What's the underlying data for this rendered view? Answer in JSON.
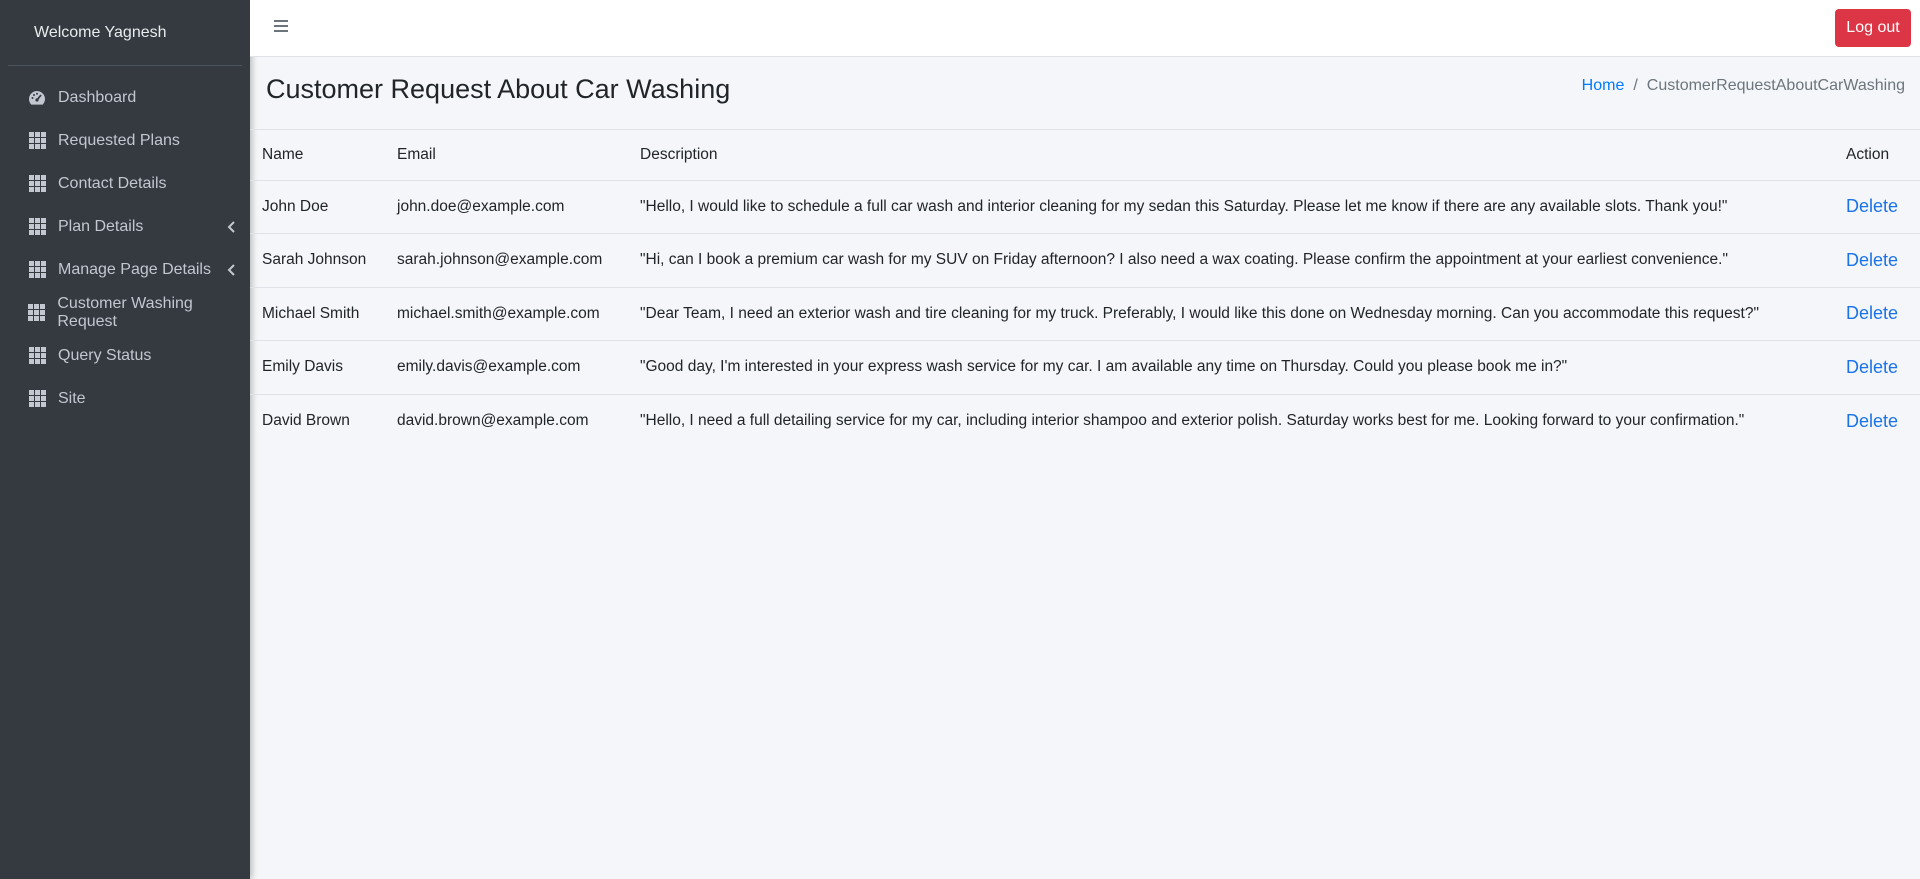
{
  "sidebar": {
    "welcome": "Welcome Yagnesh",
    "items": [
      {
        "label": "Dashboard",
        "icon": "gauge-icon"
      },
      {
        "label": "Requested Plans",
        "icon": "grid-icon"
      },
      {
        "label": "Contact Details",
        "icon": "grid-icon"
      },
      {
        "label": "Plan Details",
        "icon": "grid-icon",
        "expandable": true
      },
      {
        "label": "Manage Page Details",
        "icon": "grid-icon",
        "expandable": true
      },
      {
        "label": "Customer Washing Request",
        "icon": "grid-icon"
      },
      {
        "label": "Query Status",
        "icon": "grid-icon"
      },
      {
        "label": "Site",
        "icon": "grid-icon"
      }
    ]
  },
  "topbar": {
    "logout_label": "Log out"
  },
  "header": {
    "title": "Customer Request About Car Washing",
    "breadcrumb_home": "Home",
    "breadcrumb_sep": "/",
    "breadcrumb_current": "CustomerRequestAboutCarWashing"
  },
  "table": {
    "columns": [
      "Name",
      "Email",
      "Description",
      "Action"
    ],
    "rows": [
      {
        "name": "John Doe",
        "email": "john.doe@example.com",
        "description": "\"Hello, I would like to schedule a full car wash and interior cleaning for my sedan this Saturday. Please let me know if there are any available slots. Thank you!\"",
        "action": "Delete"
      },
      {
        "name": "Sarah Johnson",
        "email": "sarah.johnson@example.com",
        "description": "\"Hi, can I book a premium car wash for my SUV on Friday afternoon? I also need a wax coating. Please confirm the appointment at your earliest convenience.\"",
        "action": "Delete"
      },
      {
        "name": "Michael Smith",
        "email": "michael.smith@example.com",
        "description": "\"Dear Team, I need an exterior wash and tire cleaning for my truck. Preferably, I would like this done on Wednesday morning. Can you accommodate this request?\"",
        "action": "Delete"
      },
      {
        "name": "Emily Davis",
        "email": "emily.davis@example.com",
        "description": "\"Good day, I'm interested in your express wash service for my car. I am available any time on Thursday. Could you please book me in?\"",
        "action": "Delete"
      },
      {
        "name": "David Brown",
        "email": "david.brown@example.com",
        "description": "\"Hello, I need a full detailing service for my car, including interior shampoo and exterior polish. Saturday works best for me. Looking forward to your confirmation.\"",
        "action": "Delete"
      }
    ]
  },
  "colors": {
    "sidebar_bg": "#343a40",
    "logout_bg": "#dc3545",
    "link": "#007bff"
  }
}
